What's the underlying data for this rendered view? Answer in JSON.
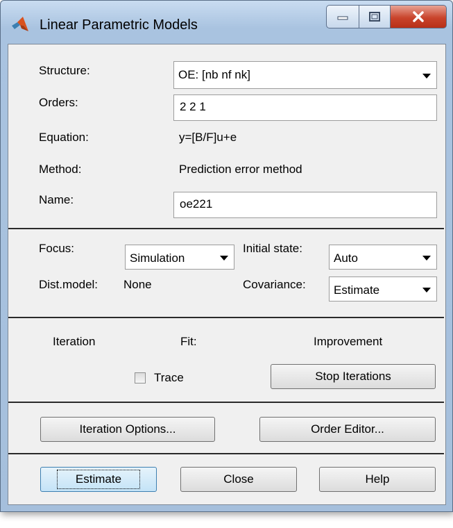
{
  "window": {
    "title": "Linear Parametric Models"
  },
  "model": {
    "structure_label": "Structure:",
    "structure_value": "OE: [nb nf nk]",
    "orders_label": "Orders:",
    "orders_value": "2 2 1",
    "equation_label": "Equation:",
    "equation_value": "y=[B/F]u+e",
    "method_label": "Method:",
    "method_value": "Prediction error method",
    "name_label": "Name:",
    "name_value": "oe221"
  },
  "options": {
    "focus_label": "Focus:",
    "focus_value": "Simulation",
    "initial_state_label": "Initial state:",
    "initial_state_value": "Auto",
    "dist_model_label": "Dist.model:",
    "dist_model_value": "None",
    "covariance_label": "Covariance:",
    "covariance_value": "Estimate"
  },
  "iteration": {
    "iteration_label": "Iteration",
    "fit_label": "Fit:",
    "improvement_label": "Improvement",
    "trace_label": "Trace",
    "trace_checked": false,
    "stop_label": "Stop Iterations"
  },
  "editors": {
    "iteration_options_label": "Iteration Options...",
    "order_editor_label": "Order Editor..."
  },
  "actions": {
    "estimate_label": "Estimate",
    "close_label": "Close",
    "help_label": "Help"
  }
}
